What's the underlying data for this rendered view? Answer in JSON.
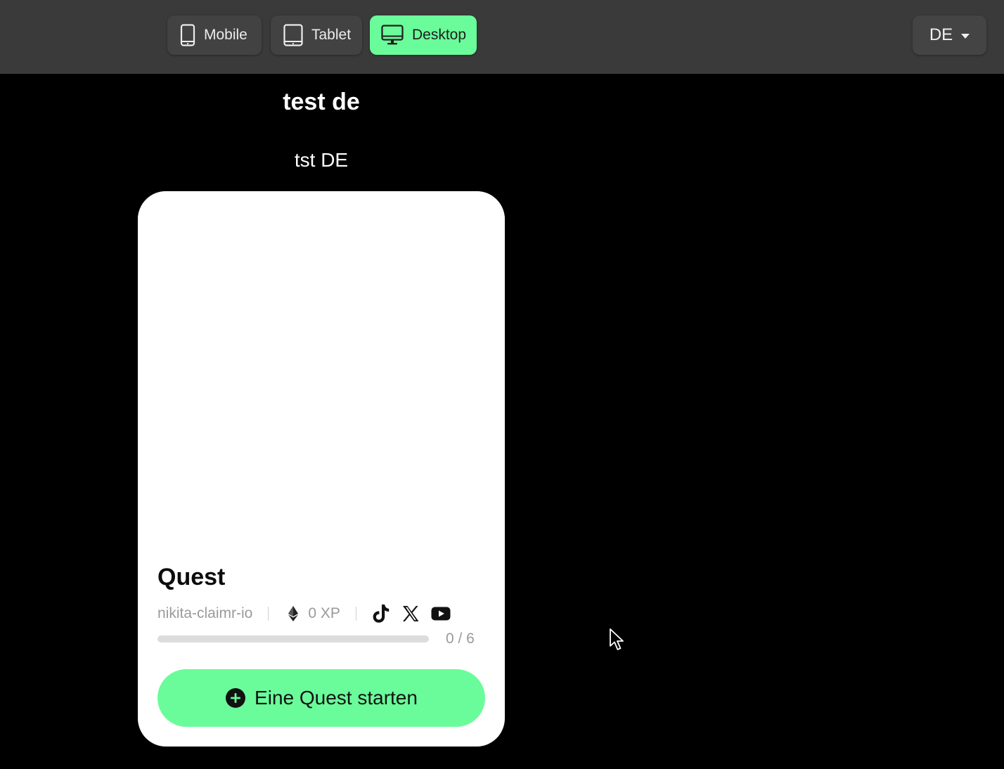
{
  "toolbar": {
    "devices": [
      {
        "label": "Mobile",
        "icon": "mobile-phone-icon",
        "active": false
      },
      {
        "label": "Tablet",
        "icon": "tablet-icon",
        "active": false
      },
      {
        "label": "Desktop",
        "icon": "desktop-monitor-icon",
        "active": true
      }
    ],
    "language": {
      "label": "DE",
      "icon": "caret-down-icon"
    }
  },
  "page": {
    "title": "test de",
    "subtitle": "tst DE"
  },
  "quest_card": {
    "title": "Quest",
    "author": "nikita-claimr-io",
    "xp": "0 XP",
    "xp_icon": "ethereum-icon",
    "social_icons": [
      "tiktok-icon",
      "x-icon",
      "youtube-icon"
    ],
    "progress": {
      "completed": 0,
      "total": 6,
      "label": "0 / 6"
    },
    "start_button": {
      "label": "Eine Quest starten",
      "icon": "plus-circle-icon"
    }
  },
  "colors": {
    "accent": "#6afc9a",
    "toolbar_bg": "#3a3a3a",
    "page_bg": "#000000",
    "card_bg": "#ffffff",
    "muted_text": "#9a9a9a"
  }
}
